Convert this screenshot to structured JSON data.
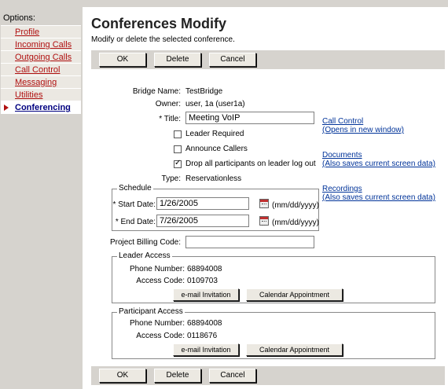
{
  "sidebar": {
    "title": "Options:",
    "items": [
      {
        "label": "Profile"
      },
      {
        "label": "Incoming Calls"
      },
      {
        "label": "Outgoing Calls"
      },
      {
        "label": "Call Control"
      },
      {
        "label": "Messaging"
      },
      {
        "label": "Utilities"
      },
      {
        "label": "Conferencing"
      }
    ],
    "active_index": 6
  },
  "page": {
    "title": "Conferences Modify",
    "subtitle": "Modify or delete the selected conference."
  },
  "buttons": {
    "ok": "OK",
    "delete": "Delete",
    "cancel": "Cancel"
  },
  "form": {
    "bridge_name_label": "Bridge Name:",
    "bridge_name": "TestBridge",
    "owner_label": "Owner:",
    "owner": "user, 1a (user1a)",
    "title_label": "* Title:",
    "title_value": "Meeting VoIP",
    "leader_required": {
      "label": "Leader Required",
      "checked": false
    },
    "announce_callers": {
      "label": "Announce Callers",
      "checked": false
    },
    "drop_all": {
      "label": "Drop all participants on leader log out",
      "checked": true
    },
    "type_label": "Type:",
    "type_value": "Reservationless",
    "project_billing_label": "Project Billing Code:",
    "project_billing_value": ""
  },
  "schedule": {
    "legend": "Schedule",
    "start_label": "* Start Date:",
    "start_value": "1/26/2005",
    "end_label": "* End Date:",
    "end_value": "7/26/2005",
    "date_format": "(mm/dd/yyyy)"
  },
  "links": {
    "call_control": "Call Control",
    "call_control_sub": "(Opens in new window)",
    "documents": "Documents",
    "documents_sub": "(Also saves current screen data)",
    "recordings": "Recordings",
    "recordings_sub": "(Also saves current screen data)"
  },
  "leader_access": {
    "legend": "Leader Access",
    "phone_label": "Phone Number:",
    "phone": "68894008",
    "code_label": "Access Code:",
    "code": "0109703",
    "email_btn": "e-mail Invitation",
    "calendar_btn": "Calendar Appointment"
  },
  "participant_access": {
    "legend": "Participant Access",
    "phone_label": "Phone Number:",
    "phone": "68894008",
    "code_label": "Access Code:",
    "code": "0118676",
    "email_btn": "e-mail Invitation",
    "calendar_btn": "Calendar Appointment"
  }
}
